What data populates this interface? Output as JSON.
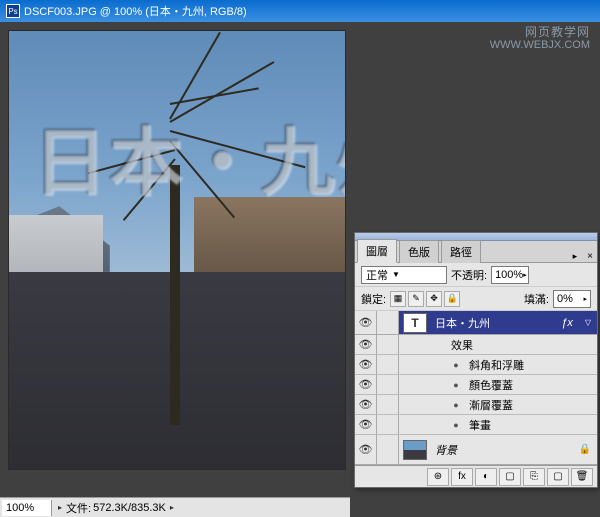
{
  "window": {
    "title": "DSCF003.JPG @ 100% (日本・九州, RGB/8)",
    "ps_icon": "Ps"
  },
  "watermark_site": {
    "cn": "网页教学网",
    "url": "WWW.WEBJX.COM"
  },
  "overlay_text": "日本・九州",
  "statusbar": {
    "zoom": "100%",
    "doc_label": "文件:",
    "doc_size": "572.3K/835.3K"
  },
  "panel": {
    "tabs": [
      "圖層",
      "色版",
      "路徑"
    ],
    "active_tab": 0,
    "blend_mode": "正常",
    "opacity_label": "不透明:",
    "opacity_value": "100%",
    "lock_label": "鎖定:",
    "fill_label": "填滿:",
    "fill_value": "0%",
    "lock_icons": [
      "▦",
      "✎",
      "✥",
      "🔒"
    ],
    "layers": [
      {
        "type": "text",
        "name": "日本・九州",
        "thumb": "T",
        "selected": true,
        "fx": true
      },
      {
        "type": "group",
        "name": "效果"
      },
      {
        "type": "effect",
        "name": "斜角和浮雕"
      },
      {
        "type": "effect",
        "name": "顏色覆蓋"
      },
      {
        "type": "effect",
        "name": "漸層覆蓋"
      },
      {
        "type": "effect",
        "name": "筆畫"
      },
      {
        "type": "bg",
        "name": "背景",
        "locked": true
      }
    ],
    "footer_icons": [
      "⊛",
      "fx",
      "◐",
      "▢",
      "⎘",
      "▢",
      "🗑"
    ]
  }
}
